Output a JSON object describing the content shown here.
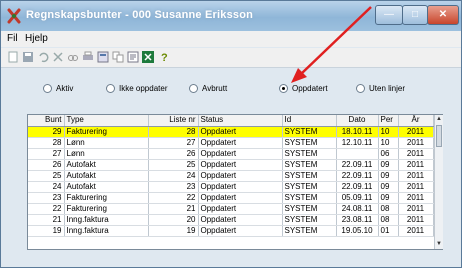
{
  "window": {
    "title": "Regnskapsbunter - 000 Susanne Eriksson",
    "controls": {
      "minimize": "—",
      "maximize": "□",
      "close": "✕"
    }
  },
  "menu": {
    "items": [
      "Fil",
      "Hjelp"
    ]
  },
  "toolbar": {
    "icons": [
      "new-doc-icon",
      "save-icon",
      "undo-icon",
      "delete-icon",
      "find-icon",
      "print-icon",
      "preview-icon",
      "copy-icon",
      "properties-icon",
      "excel-icon",
      "help-icon"
    ]
  },
  "filter": {
    "options": [
      "Aktiv",
      "Ikke oppdater",
      "Avbrutt",
      "Oppdatert",
      "Uten linjer"
    ],
    "selected": "Oppdatert"
  },
  "grid": {
    "columns": [
      "Bunt",
      "Type",
      "Liste nr",
      "Status",
      "Id",
      "Dato",
      "Per",
      "År"
    ],
    "rows": [
      [
        "29",
        "Fakturering",
        "28",
        "Oppdatert",
        "SYSTEM",
        "18.10.11",
        "10",
        "2011"
      ],
      [
        "28",
        "Lønn",
        "27",
        "Oppdatert",
        "SYSTEM",
        "12.10.11",
        "10",
        "2011"
      ],
      [
        "27",
        "Lønn",
        "26",
        "Oppdatert",
        "SYSTEM",
        "",
        "06",
        "2011"
      ],
      [
        "26",
        "Autofakt",
        "25",
        "Oppdatert",
        "SYSTEM",
        "22.09.11",
        "09",
        "2011"
      ],
      [
        "25",
        "Autofakt",
        "24",
        "Oppdatert",
        "SYSTEM",
        "22.09.11",
        "09",
        "2011"
      ],
      [
        "24",
        "Autofakt",
        "23",
        "Oppdatert",
        "SYSTEM",
        "22.09.11",
        "09",
        "2011"
      ],
      [
        "23",
        "Fakturering",
        "22",
        "Oppdatert",
        "SYSTEM",
        "05.09.11",
        "09",
        "2011"
      ],
      [
        "22",
        "Fakturering",
        "21",
        "Oppdatert",
        "SYSTEM",
        "24.08.11",
        "08",
        "2011"
      ],
      [
        "21",
        "Inng.faktura",
        "20",
        "Oppdatert",
        "SYSTEM",
        "23.08.11",
        "08",
        "2011"
      ],
      [
        "19",
        "Inng.faktura",
        "19",
        "Oppdatert",
        "SYSTEM",
        "19.05.10",
        "01",
        "2011"
      ]
    ],
    "selected_row": 0,
    "highlight_color": "#ffff00"
  },
  "annotation": {
    "color": "#e02020"
  }
}
